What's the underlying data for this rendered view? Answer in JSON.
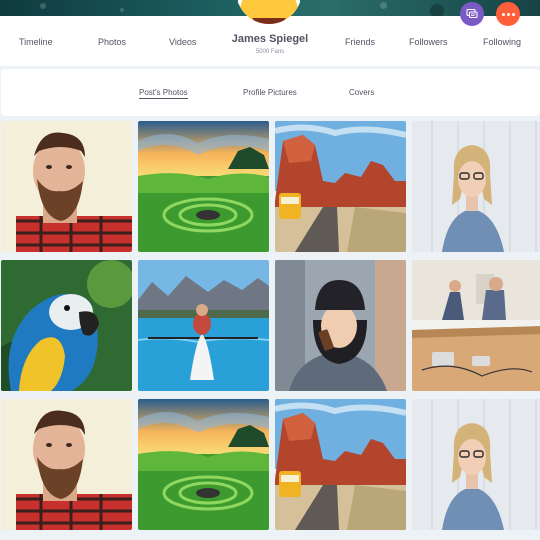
{
  "profile": {
    "name": "James Spiegel",
    "fans": "5000 Fans"
  },
  "nav": {
    "timeline": "Timeline",
    "photos": "Photos",
    "videos": "Videos",
    "friends": "Friends",
    "followers": "Followers",
    "following": "Following"
  },
  "actions": {
    "chat_icon": "chat-bubble-icon",
    "more_icon": "more-dots-icon"
  },
  "tabs": {
    "posts_photos": "Post's Photos",
    "profile_pictures": "Profile Pictures",
    "covers": "Covers"
  },
  "photos": [
    {
      "subject": "bearded-man-plaid-shirt"
    },
    {
      "subject": "green-landscape-sunset"
    },
    {
      "subject": "red-rock-desert-road-van"
    },
    {
      "subject": "woman-glasses-blue-shirt"
    },
    {
      "subject": "blue-yellow-macaw-parrot"
    },
    {
      "subject": "kayak-mountain-lake"
    },
    {
      "subject": "woman-beanie-phone-call"
    },
    {
      "subject": "office-desk-people"
    },
    {
      "subject": "bearded-man-plaid-shirt"
    },
    {
      "subject": "green-landscape-sunset"
    },
    {
      "subject": "red-rock-desert-road-van"
    },
    {
      "subject": "woman-glasses-blue-shirt"
    }
  ],
  "colors": {
    "chat_button": "#7c5ac5",
    "more_button": "#ff5e3a",
    "text": "#515365",
    "muted": "#888da8",
    "background": "#edf2f6"
  }
}
